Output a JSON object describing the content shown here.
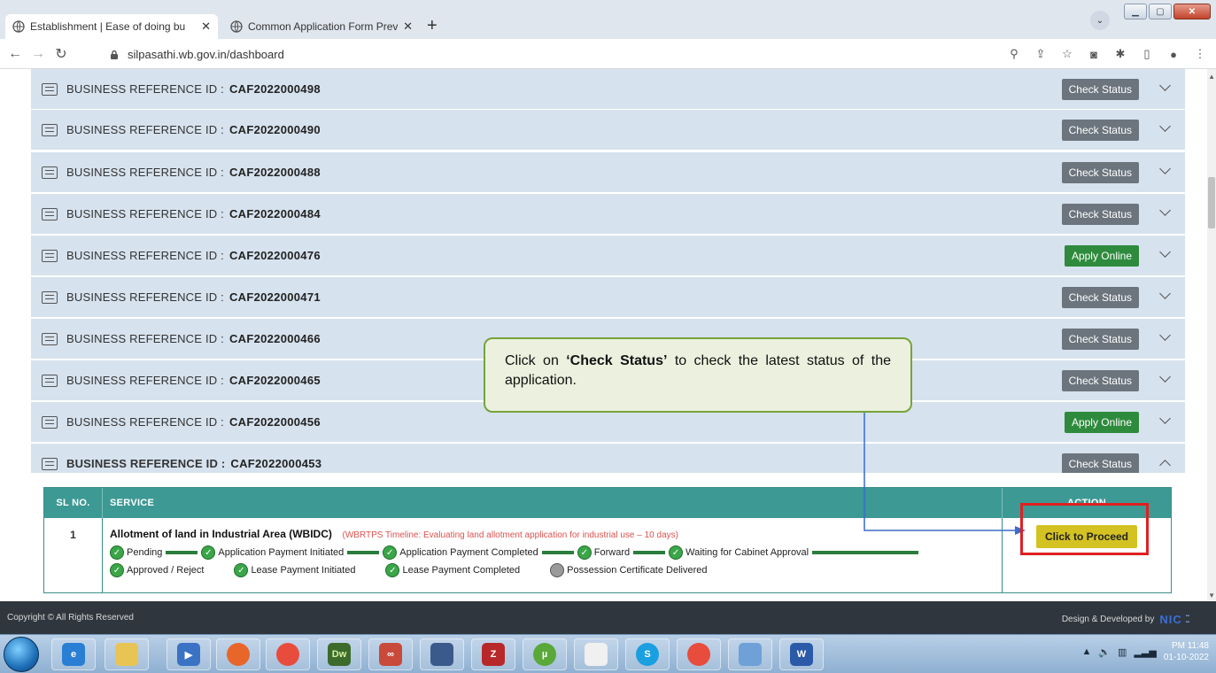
{
  "browser": {
    "tabs": [
      {
        "title": "Establishment | Ease of doing bu",
        "active": true
      },
      {
        "title": "Common Application Form Previ",
        "active": false
      }
    ],
    "new_tab": "+",
    "url": "silpasathi.wb.gov.in/dashboard"
  },
  "rows": [
    {
      "label": "BUSINESS REFERENCE ID :",
      "id": "CAF2022000498",
      "action": "Check Status"
    },
    {
      "label": "BUSINESS REFERENCE ID :",
      "id": "CAF2022000490",
      "action": "Check Status"
    },
    {
      "label": "BUSINESS REFERENCE ID :",
      "id": "CAF2022000488",
      "action": "Check Status"
    },
    {
      "label": "BUSINESS REFERENCE ID :",
      "id": "CAF2022000484",
      "action": "Check Status"
    },
    {
      "label": "BUSINESS REFERENCE ID :",
      "id": "CAF2022000476",
      "action": "Apply Online"
    },
    {
      "label": "BUSINESS REFERENCE ID :",
      "id": "CAF2022000471",
      "action": "Check Status"
    },
    {
      "label": "BUSINESS REFERENCE ID :",
      "id": "CAF2022000466",
      "action": "Check Status"
    },
    {
      "label": "BUSINESS REFERENCE ID :",
      "id": "CAF2022000465",
      "action": "Check Status"
    },
    {
      "label": "BUSINESS REFERENCE ID :",
      "id": "CAF2022000456",
      "action": "Apply Online"
    },
    {
      "label": "BUSINESS REFERENCE ID :",
      "id": "CAF2022000453",
      "action": "Check Status"
    }
  ],
  "table": {
    "headers": {
      "sl": "SL NO.",
      "service": "SERVICE",
      "action": "ACTION"
    },
    "row": {
      "sl": "1",
      "service": "Allotment of land in Industrial Area (WBIDC)",
      "timeline": "(WBRTPS Timeline: Evaluating land allotment application for industrial use – 10 days)",
      "steps_line1": [
        "Pending",
        "Application Payment Initiated",
        "Application Payment Completed",
        "Forward",
        "Waiting for Cabinet Approval"
      ],
      "steps_line2": [
        "Approved / Reject",
        "Lease Payment Initiated",
        "Lease Payment Completed",
        "Possession Certificate Delivered"
      ],
      "action": "Click to Proceed"
    }
  },
  "callout": {
    "pre": "Click on ",
    "bold": "‘Check Status’",
    "post": " to check the latest status of the application."
  },
  "footer": {
    "copyright": "Copyright © All Rights Reserved",
    "developed": "Design & Developed by",
    "logo": "NIC"
  },
  "taskbar": {
    "time": "PM 11:48",
    "date": "01-10-2022"
  },
  "colors": {
    "row_bg": "#d6e2ee",
    "check_status": "#6c757d",
    "apply_online": "#2e8b3d",
    "table_header": "#3d9994",
    "proceed": "#d4c222",
    "highlight": "#e02020"
  }
}
